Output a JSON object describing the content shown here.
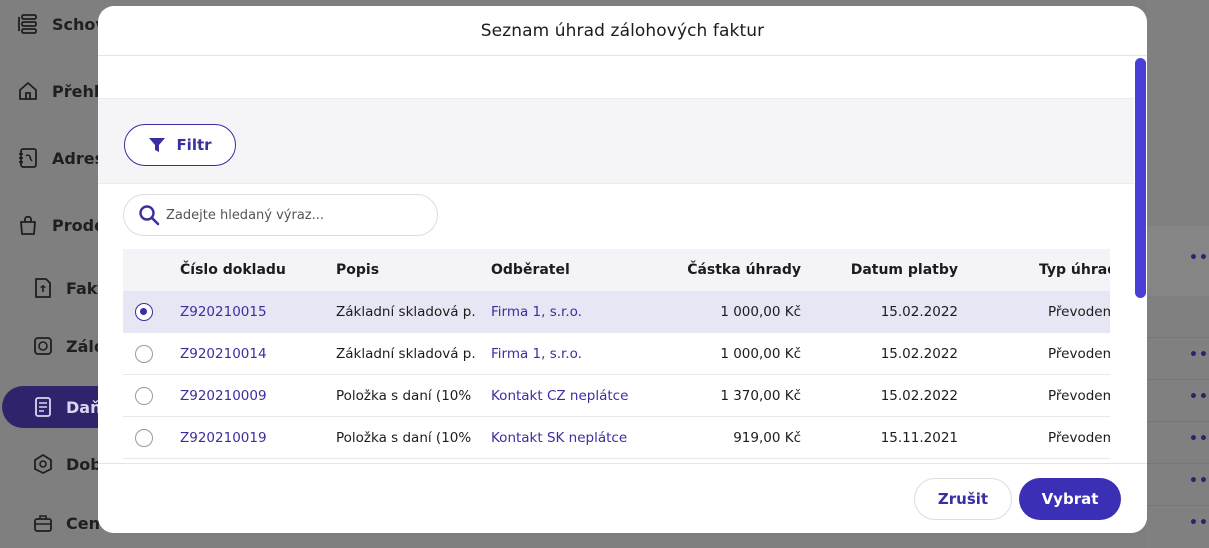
{
  "sidebar": {
    "items": [
      {
        "label": "Schov",
        "icon": "layers-icon"
      },
      {
        "label": "Přehle",
        "icon": "home-icon"
      },
      {
        "label": "Adresa",
        "icon": "address-book-icon"
      },
      {
        "label": "Prodej",
        "icon": "shopping-bag-icon"
      }
    ],
    "subitems": [
      {
        "label": "Fakt",
        "icon": "invoice-icon"
      },
      {
        "label": "Zálo",
        "icon": "deposit-icon"
      },
      {
        "label": "Daň",
        "icon": "tax-document-icon",
        "active": true
      },
      {
        "label": "Dob",
        "icon": "credit-note-icon"
      },
      {
        "label": "Cen",
        "icon": "price-list-icon"
      }
    ]
  },
  "modal": {
    "title": "Seznam úhrad zálohových faktur",
    "filter_label": "Filtr",
    "search": {
      "placeholder": "Zadejte hledaný výraz...",
      "value": ""
    },
    "table": {
      "headers": [
        "Číslo dokladu",
        "Popis",
        "Odběratel",
        "Částka úhrady",
        "Datum platby",
        "Typ úhrady"
      ],
      "rows": [
        {
          "selected": true,
          "cislo": "Z920210015",
          "popis": "Základní skladová p...",
          "odberatel": "Firma 1, s.r.o.",
          "castka": "1 000,00 Kč",
          "datum": "15.02.2022",
          "typ": "Převodem"
        },
        {
          "selected": false,
          "cislo": "Z920210014",
          "popis": "Základní skladová p...",
          "odberatel": "Firma 1, s.r.o.",
          "castka": "1 000,00 Kč",
          "datum": "15.02.2022",
          "typ": "Převodem"
        },
        {
          "selected": false,
          "cislo": "Z920210009",
          "popis": "Položka s daní (10% ...",
          "odberatel": "Kontakt CZ neplátce",
          "castka": "1 370,00 Kč",
          "datum": "15.02.2022",
          "typ": "Převodem"
        },
        {
          "selected": false,
          "cislo": "Z920210019",
          "popis": "Položka s daní (10% ...",
          "odberatel": "Kontakt SK neplátce",
          "castka": "919,00 Kč",
          "datum": "15.11.2021",
          "typ": "Převodem"
        }
      ]
    },
    "cancel_label": "Zrušit",
    "select_label": "Vybrat"
  },
  "colors": {
    "accent": "#3a2fa0",
    "primary_button": "#3a2fb5",
    "scrollbar": "#4a3ed6",
    "selected_row": "#e7e6f4"
  }
}
